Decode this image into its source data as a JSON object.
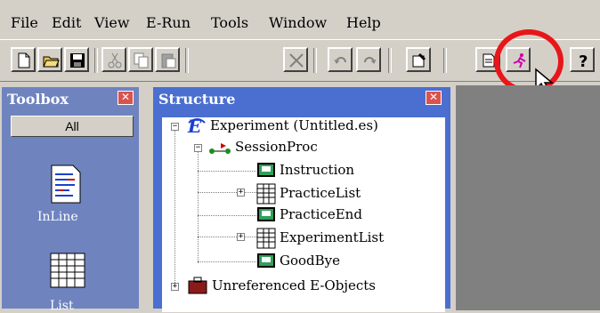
{
  "menu": [
    "File",
    "Edit",
    "View",
    "E-Run",
    "Tools",
    "Window",
    "Help"
  ],
  "toolbox": {
    "title": "Toolbox",
    "all_label": "All",
    "items": [
      {
        "label": "InLine",
        "icon": "inline-script-icon"
      },
      {
        "label": "List",
        "icon": "list-grid-icon"
      }
    ]
  },
  "structure": {
    "title": "Structure",
    "nodes": [
      {
        "label": "Experiment (Untitled.es)",
        "icon": "experiment-e-icon"
      },
      {
        "label": "SessionProc",
        "icon": "procedure-icon"
      },
      {
        "label": "Instruction",
        "icon": "text-display-icon"
      },
      {
        "label": "PracticeList",
        "icon": "list-icon"
      },
      {
        "label": "PracticeEnd",
        "icon": "text-display-icon"
      },
      {
        "label": "ExperimentList",
        "icon": "list-icon"
      },
      {
        "label": "GoodBye",
        "icon": "text-display-icon"
      },
      {
        "label": "Unreferenced E-Objects",
        "icon": "briefcase-icon"
      }
    ]
  },
  "colors": {
    "highlight": "#e8161b",
    "panel_title": "#4b6fd0",
    "toolbox_bg": "#6f83bf"
  }
}
